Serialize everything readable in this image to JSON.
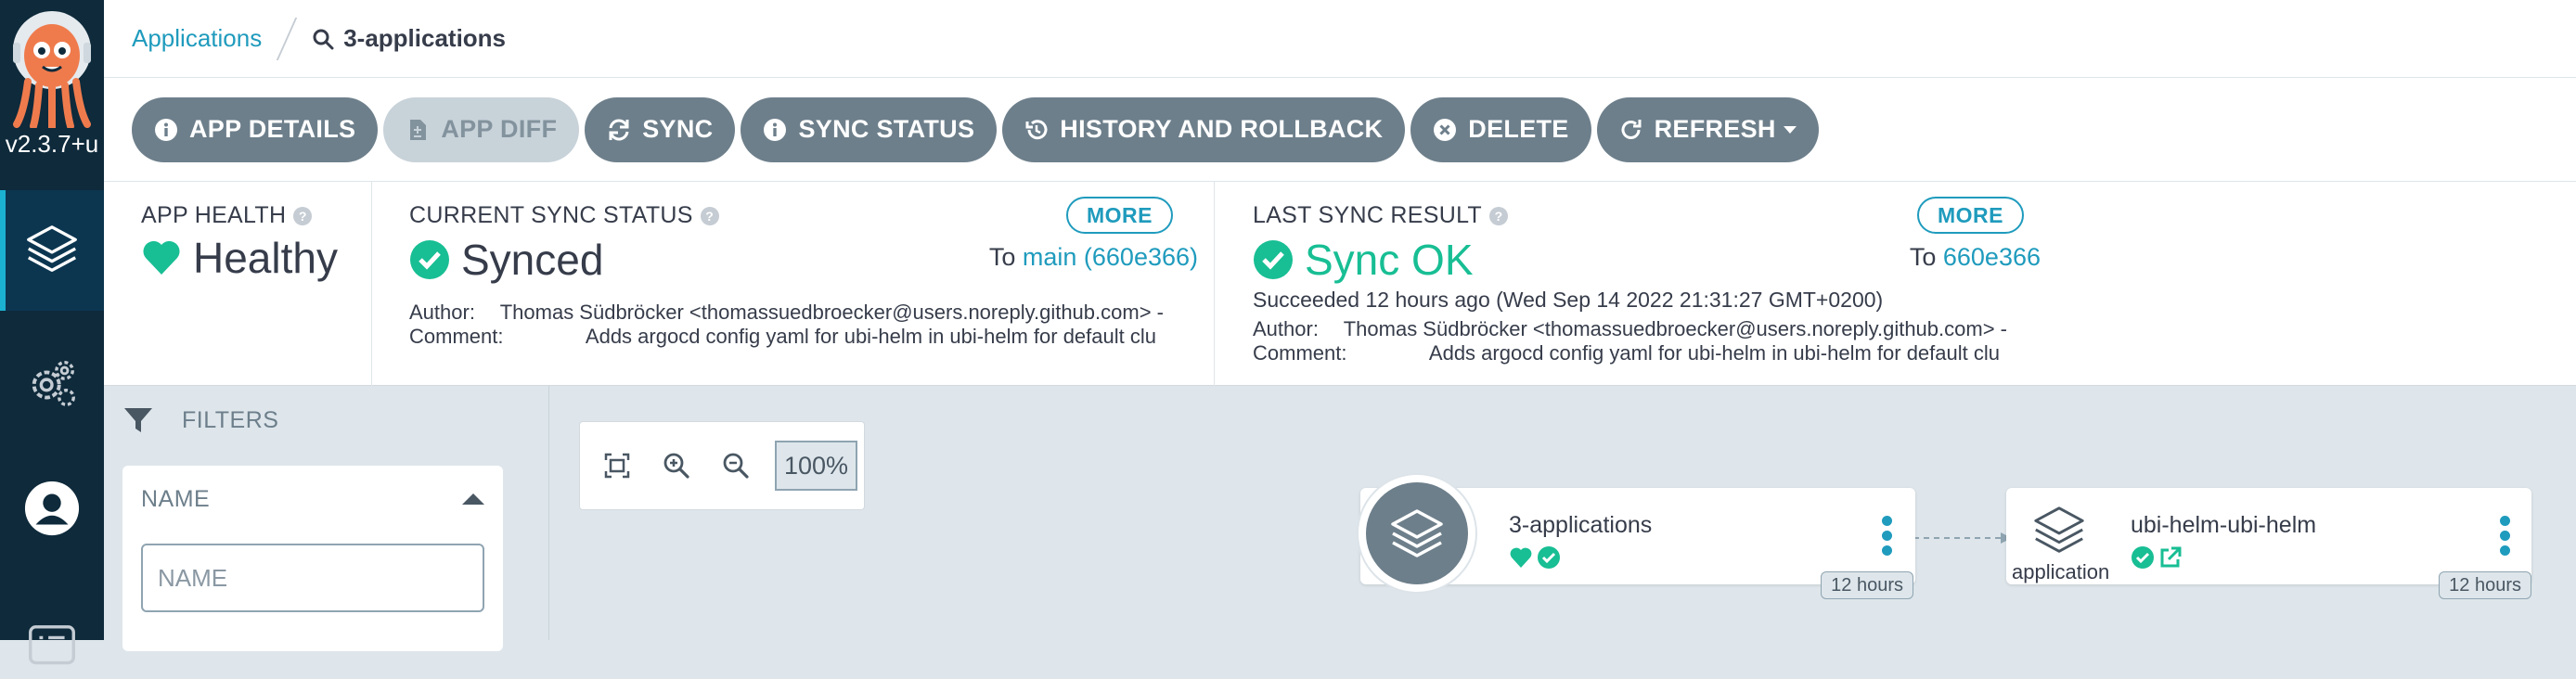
{
  "nav": {
    "version": "v2.3.7+u",
    "items": [
      {
        "icon": "layers-icon",
        "name": "applications"
      },
      {
        "icon": "gears-icon",
        "name": "settings"
      },
      {
        "icon": "user-icon",
        "name": "user-info"
      },
      {
        "icon": "docs-icon",
        "name": "documentation"
      }
    ]
  },
  "breadcrumb": {
    "root": "Applications",
    "current": "3-applications"
  },
  "toolbar": {
    "app_details": "APP DETAILS",
    "app_diff": "APP DIFF",
    "sync": "SYNC",
    "sync_status": "SYNC STATUS",
    "history": "HISTORY AND ROLLBACK",
    "delete": "DELETE",
    "refresh": "REFRESH"
  },
  "status": {
    "app_health": {
      "title": "APP HEALTH",
      "value": "Healthy",
      "color": "#18be94"
    },
    "current_sync": {
      "title": "CURRENT SYNC STATUS",
      "value": "Synced",
      "more": "MORE",
      "to_prefix": "To",
      "to_revision": "main (660e366)",
      "author_label": "Author:",
      "author_value": "Thomas Südbröcker <thomassuedbroecker@users.noreply.github.com> -",
      "comment_label": "Comment:",
      "comment_value": "Adds argocd config yaml for ubi-helm in ubi-helm for default clu",
      "color": "#18be94"
    },
    "last_sync": {
      "title": "LAST SYNC RESULT",
      "value": "Sync OK",
      "more": "MORE",
      "to_prefix": "To",
      "to_revision": "660e366",
      "succeeded": "Succeeded 12 hours ago (Wed Sep 14 2022 21:31:27 GMT+0200)",
      "author_label": "Author:",
      "author_value": "Thomas Südbröcker <thomassuedbroecker@users.noreply.github.com> -",
      "comment_label": "Comment:",
      "comment_value": "Adds argocd config yaml for ubi-helm in ubi-helm for default clu",
      "color": "#18be94"
    }
  },
  "filters": {
    "title": "FILTERS",
    "name_section": "NAME",
    "name_placeholder": "NAME"
  },
  "graph": {
    "zoom_level": "100%",
    "nodes": [
      {
        "name": "3-applications",
        "age": "12 hours",
        "kind": ""
      },
      {
        "name": "ubi-helm-ubi-helm",
        "age": "12 hours",
        "kind": "application"
      }
    ]
  },
  "colors": {
    "accent": "#1f9bbd",
    "nav_bg": "#0e2a3b",
    "button_bg": "#6d7f8b",
    "healthy": "#18be94"
  }
}
